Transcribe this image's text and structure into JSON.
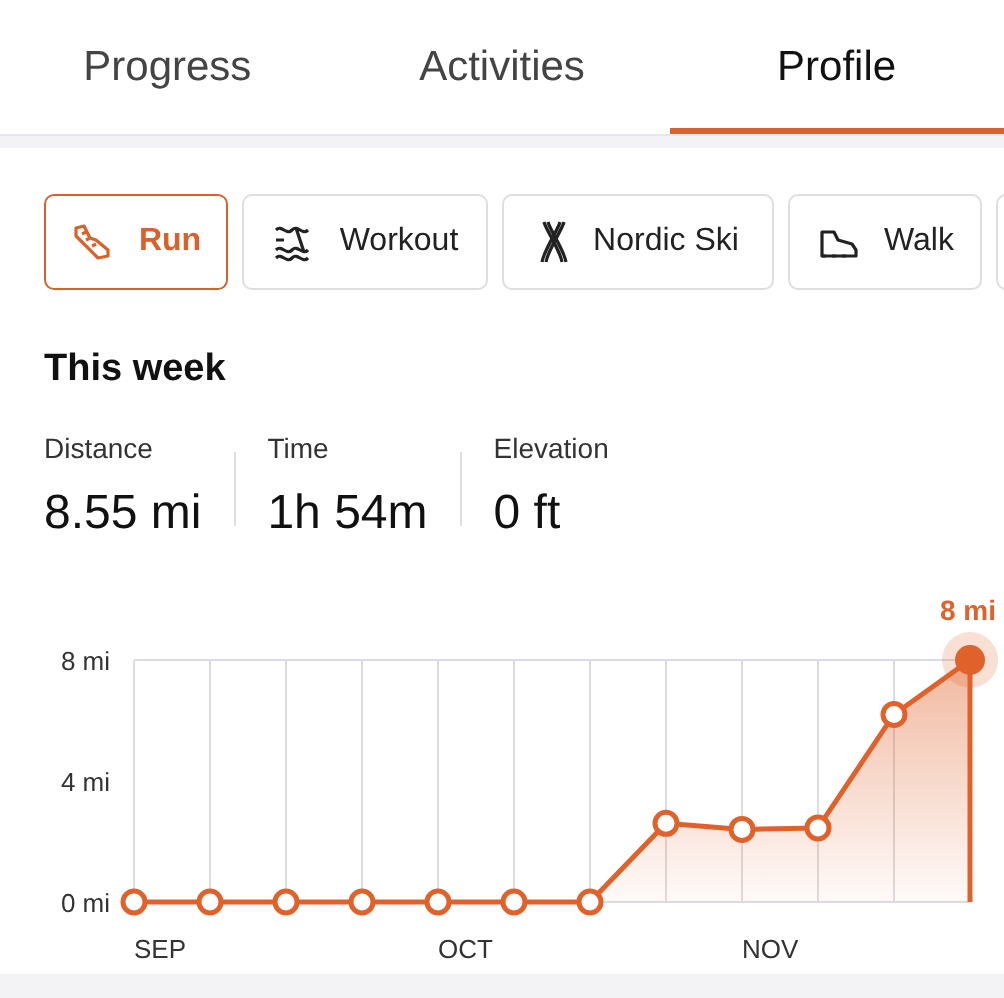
{
  "tabs": [
    {
      "label": "Progress",
      "selected": false
    },
    {
      "label": "Activities",
      "selected": false
    },
    {
      "label": "Profile",
      "selected": true
    }
  ],
  "activity_chips": [
    {
      "label": "Run",
      "kind": "run",
      "selected": true
    },
    {
      "label": "Workout",
      "kind": "workout",
      "selected": false
    },
    {
      "label": "Nordic Ski",
      "kind": "ski",
      "selected": false
    },
    {
      "label": "Walk",
      "kind": "walk",
      "selected": false
    },
    {
      "kind": "more",
      "selected": false
    }
  ],
  "section_title": "This week",
  "stats": [
    {
      "label": "Distance",
      "value": "8.55 mi"
    },
    {
      "label": "Time",
      "value": "1h 54m"
    },
    {
      "label": "Elevation",
      "value": "0 ft"
    }
  ],
  "chart_data": {
    "type": "area",
    "categories": [
      "SEP",
      null,
      null,
      null,
      "OCT",
      null,
      null,
      null,
      "NOV",
      null,
      null,
      null
    ],
    "series": [
      {
        "color": "#e0622a",
        "values": [
          0,
          0,
          0,
          0,
          0,
          0,
          0,
          2.6,
          2.4,
          2.45,
          6.2,
          8
        ]
      }
    ],
    "ylim": [
      0,
      8
    ],
    "yticks": [
      {
        "value": 0,
        "label": "0 mi"
      },
      {
        "value": 4,
        "label": "4 mi"
      },
      {
        "value": 8,
        "label": "8 mi"
      }
    ],
    "annotations": [
      {
        "y": 8,
        "text": "8 mi"
      }
    ]
  }
}
